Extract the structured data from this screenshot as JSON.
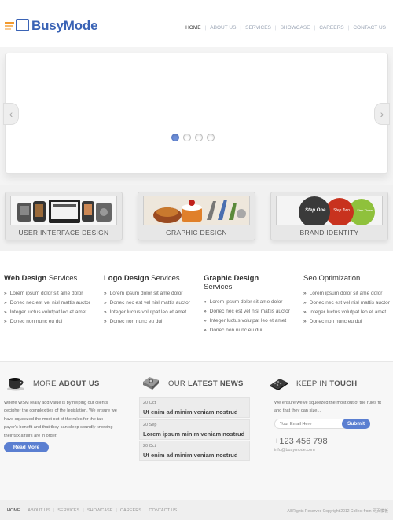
{
  "header": {
    "logo_text": "BusyMode",
    "nav": [
      "HOME",
      "ABOUT US",
      "SERVICES",
      "SHOWCASE",
      "CAREERS",
      "CONTACT US"
    ],
    "active_index": 0
  },
  "slider": {
    "left_arrow": "‹",
    "right_arrow": "›",
    "dot_count": 4,
    "active_dot": 0
  },
  "features": [
    {
      "caption": "USER INTERFACE DESIGN",
      "thumb": "ui-design-thumbnail"
    },
    {
      "caption": "GRAPHIC DESIGN",
      "thumb": "graphic-design-thumbnail"
    },
    {
      "caption": "BRAND IDENTITY",
      "thumb": "brand-identity-thumbnail"
    }
  ],
  "feature_thumb_text": {
    "step_one": "Step One",
    "step_two": "Step Two",
    "step_three": "Step Three"
  },
  "services": [
    {
      "bold": "Web Design",
      "rest": " Services",
      "items": [
        "Lorem ipsum dolor sit ame dolor",
        "Donec nec est vel nisl mattis auctor",
        "Integer luctus volutpat leo et amet",
        "Donec non nunc eu dui"
      ]
    },
    {
      "bold": "Logo Design",
      "rest": " Services",
      "items": [
        "Lorem ipsum dolor sit ame dolor",
        "Donec nec est vel nisl mattis auctor",
        "Integer luctus volutpat leo et amet",
        "Donec non nunc eu dui"
      ]
    },
    {
      "bold": "Graphic Design",
      "rest": " Services",
      "items": [
        "Lorem ipsum dolor sit ame dolor",
        "Donec nec est vel nisl mattis auctor",
        "Integer luctus volutpat leo et amet",
        "Donec non nunc eu dui"
      ]
    },
    {
      "bold": "",
      "rest": "Seo Optimization",
      "items": [
        "Lorem ipsum dolor sit ame dolor",
        "Donec nec est vel nisl mattis auctor",
        "Integer luctus volutpat leo et amet",
        "Donec non nunc eu dui"
      ]
    }
  ],
  "about": {
    "heading_pre": "MORE ",
    "heading_bold": "ABOUT US",
    "text": "Where WSM really add value is by helping our clients decipher the complexities of the legislation. We ensure we have squeezed the most out of the rules for the tax payer's benefit and that they can sleep soundly knowing their tax affairs are in order.",
    "button": "Read More"
  },
  "news": {
    "heading_pre": "OUR ",
    "heading_bold": "LATEST NEWS",
    "items": [
      {
        "date": "20 Oct",
        "title": "Ut enim ad minim veniam nostrud"
      },
      {
        "date": "20 Sep",
        "title": "Lorem ipsum minim veniam nostrud"
      },
      {
        "date": "20 Oct",
        "title": "Ut enim ad minim veniam nostrud"
      }
    ]
  },
  "touch": {
    "heading_pre": "KEEP IN ",
    "heading_bold": "TOUCH",
    "text": "We ensure we've squeezed the most out of the rules fit and that they can size...",
    "email_placeholder": "Your Email Here",
    "submit": "Submit",
    "phone": "+123 456 798",
    "email": "info@busymode.com"
  },
  "footer": {
    "nav": [
      "HOME",
      "ABOUT US",
      "SERVICES",
      "SHOWCASE",
      "CAREERS",
      "CONTACT US"
    ],
    "copyright": "All Rights Reserved Copyright 2012 Collect from 网页模板"
  },
  "colors": {
    "brand_blue": "#3a63b5",
    "accent_orange": "#f29a2e",
    "button_blue": "#5b7fd1"
  }
}
